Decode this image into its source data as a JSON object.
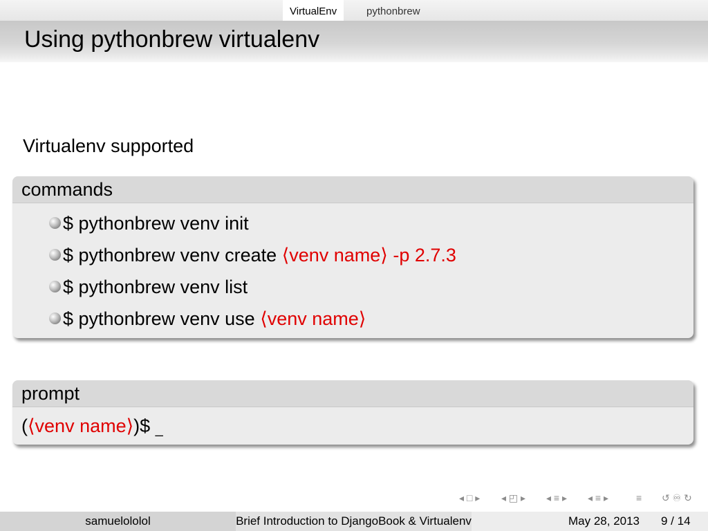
{
  "nav": {
    "tabs": [
      {
        "label": "VirtualEnv"
      },
      {
        "label": "pythonbrew"
      }
    ]
  },
  "frame": {
    "title": "Using pythonbrew virtualenv",
    "intro": "Virtualenv supported"
  },
  "commands_block": {
    "title": "commands",
    "items": [
      {
        "prefix": "$ pythonbrew venv init",
        "red": "",
        "suffix": ""
      },
      {
        "prefix": "$ pythonbrew venv create ",
        "red": "⟨venv name⟩ -p 2.7.3",
        "suffix": ""
      },
      {
        "prefix": "$ pythonbrew venv list",
        "red": "",
        "suffix": ""
      },
      {
        "prefix": "$ pythonbrew venv use ",
        "red": "⟨venv name⟩",
        "suffix": ""
      }
    ]
  },
  "prompt_block": {
    "title": "prompt",
    "open": "(",
    "red": "⟨venv name⟩",
    "close": ")$ ",
    "cursor": "_"
  },
  "nav_symbols": {
    "frame": "◂ □ ▸",
    "subsection": "◂ ◰ ▸",
    "section": "◂ ≡ ▸",
    "subsubsection": "◂ ≡ ▸",
    "align": "≡",
    "search": "↺ ♾ ↻"
  },
  "footer": {
    "author": "samuelololol",
    "title": "Brief Introduction to DjangoBook & Virtualenv",
    "date": "May 28, 2013",
    "page": "9 / 14"
  }
}
